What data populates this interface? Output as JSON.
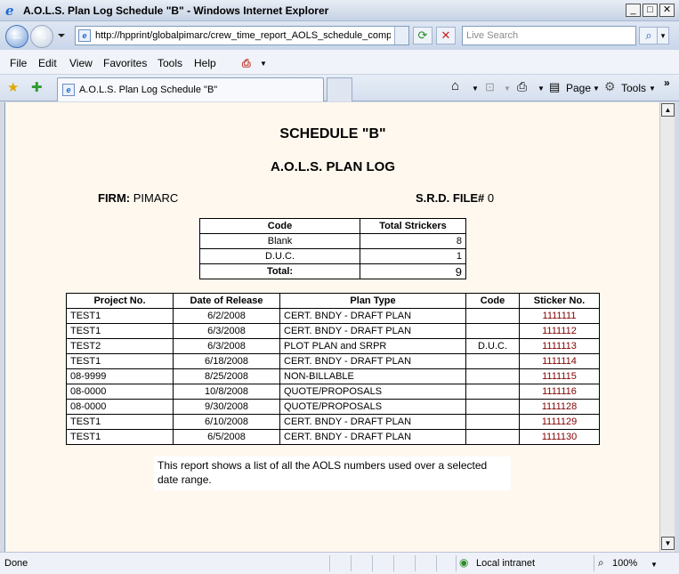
{
  "window": {
    "title": "A.O.L.S. Plan Log Schedule \"B\" - Windows Internet Explorer"
  },
  "address": {
    "url": "http://hpprint/globalpimarc/crew_time_report_AOLS_schedule_compile",
    "search_placeholder": "Live Search"
  },
  "menu": {
    "file": "File",
    "edit": "Edit",
    "view": "View",
    "favorites": "Favorites",
    "tools": "Tools",
    "help": "Help"
  },
  "tab": {
    "label": "A.O.L.S. Plan Log Schedule \"B\""
  },
  "commandbar": {
    "page": "Page",
    "tools": "Tools"
  },
  "report": {
    "schedule_title": "SCHEDULE \"B\"",
    "log_title": "A.O.L.S. PLAN LOG",
    "firm_label": "FIRM:",
    "firm_value": "PIMARC",
    "srd_label": "S.R.D. FILE#",
    "srd_value": "0",
    "summary": {
      "headers": [
        "Code",
        "Total Strickers"
      ],
      "rows": [
        {
          "code": "Blank",
          "total": "8"
        },
        {
          "code": "D.U.C.",
          "total": "1"
        }
      ],
      "total_label": "Total:",
      "total_value": "9"
    },
    "details": {
      "headers": [
        "Project No.",
        "Date of Release",
        "Plan Type",
        "Code",
        "Sticker No."
      ],
      "rows": [
        {
          "project": "TEST1",
          "date": "6/2/2008",
          "plan": "CERT. BNDY - DRAFT PLAN",
          "code": "",
          "sticker": "1111111"
        },
        {
          "project": "TEST1",
          "date": "6/3/2008",
          "plan": "CERT. BNDY - DRAFT PLAN",
          "code": "",
          "sticker": "1111112"
        },
        {
          "project": "TEST2",
          "date": "6/3/2008",
          "plan": "PLOT PLAN and SRPR",
          "code": "D.U.C.",
          "sticker": "1111113"
        },
        {
          "project": "TEST1",
          "date": "6/18/2008",
          "plan": "CERT. BNDY - DRAFT PLAN",
          "code": "",
          "sticker": "1111114"
        },
        {
          "project": "08-9999",
          "date": "8/25/2008",
          "plan": "NON-BILLABLE",
          "code": "",
          "sticker": "1111115"
        },
        {
          "project": "08-0000",
          "date": "10/8/2008",
          "plan": "QUOTE/PROPOSALS",
          "code": "",
          "sticker": "1111116"
        },
        {
          "project": "08-0000",
          "date": "9/30/2008",
          "plan": "QUOTE/PROPOSALS",
          "code": "",
          "sticker": "1111128"
        },
        {
          "project": "TEST1",
          "date": "6/10/2008",
          "plan": "CERT. BNDY - DRAFT PLAN",
          "code": "",
          "sticker": "1111129"
        },
        {
          "project": "TEST1",
          "date": "6/5/2008",
          "plan": "CERT. BNDY - DRAFT PLAN",
          "code": "",
          "sticker": "1111130"
        }
      ]
    },
    "note": "This report shows a list of all the AOLS numbers used over a selected date range."
  },
  "status": {
    "left": "Done",
    "zone": "Local intranet",
    "zoom": "100%"
  }
}
